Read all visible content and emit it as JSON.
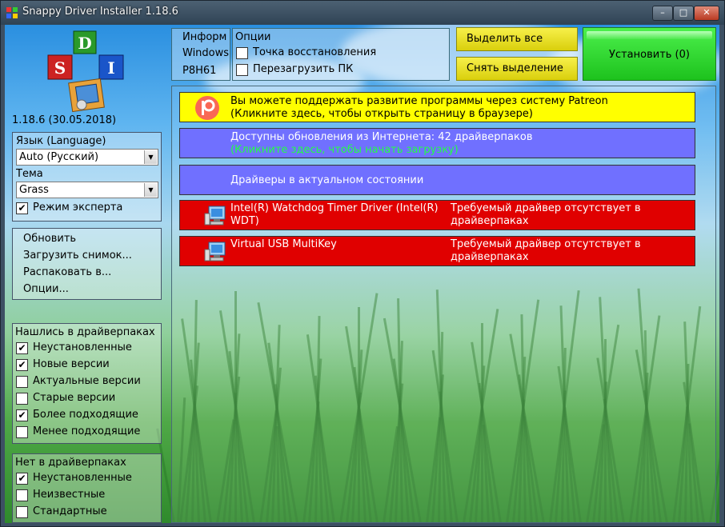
{
  "window": {
    "title": "Snappy Driver Installer 1.18.6",
    "buttons": {
      "minimize": "–",
      "maximize": "□",
      "close": "✕"
    }
  },
  "logo": {
    "letters": [
      "D",
      "S",
      "I"
    ]
  },
  "version": "1.18.6 (30.05.2018)",
  "language": {
    "label": "Язык (Language)",
    "value": "Auto (Русский)"
  },
  "theme": {
    "label": "Тема",
    "value": "Grass"
  },
  "expert_mode": {
    "label": "Режим эксперта",
    "checked": true
  },
  "actions": [
    "Обновить",
    "Загрузить снимок...",
    "Распаковать в...",
    "Опции..."
  ],
  "found_group": {
    "title": "Нашлись в драйверпаках",
    "items": [
      {
        "label": "Неустановленные",
        "checked": true
      },
      {
        "label": "Новые версии",
        "checked": true
      },
      {
        "label": "Актуальные версии",
        "checked": false
      },
      {
        "label": "Старые версии",
        "checked": false
      },
      {
        "label": "Более подходящие",
        "checked": true
      },
      {
        "label": "Менее подходящие",
        "checked": false
      }
    ]
  },
  "notfound_group": {
    "title": "Нет в драйверпаках",
    "items": [
      {
        "label": "Неустановленные",
        "checked": true
      },
      {
        "label": "Неизвестные",
        "checked": false
      },
      {
        "label": "Стандартные",
        "checked": false
      }
    ]
  },
  "info_panel": {
    "lines": [
      "Информ",
      "Windows",
      "P8H61"
    ]
  },
  "options_panel": {
    "title": "Опции",
    "items": [
      {
        "label": "Точка восстановления",
        "checked": false
      },
      {
        "label": "Перезагрузить ПК",
        "checked": false
      }
    ]
  },
  "buttons": {
    "select_all": "Выделить все",
    "deselect": "Снять выделение",
    "install": "Установить (0)"
  },
  "rows": {
    "patreon": {
      "line1": "Вы можете поддержать развитие программы через систему Patreon",
      "line2": "(Кликните здесь, чтобы открыть страницу в браузере)"
    },
    "updates": {
      "line1": "Доступны обновления из Интернета: 42 драйверпаков",
      "line2": "(Кликните здесь, чтобы начать загрузку)"
    },
    "uptodate": {
      "line1": "Драйверы в актуальном состоянии"
    },
    "driver1": {
      "name_line1": "Intel(R) Watchdog Timer Driver (Intel(R)",
      "name_line2": "WDT)",
      "status_line1": "Требуемый драйвер отсутствует в",
      "status_line2": "драйверпаках"
    },
    "driver2": {
      "name_line1": "Virtual USB MultiKey",
      "status_line1": "Требуемый драйвер отсутствует в",
      "status_line2": "драйверпаках"
    }
  },
  "colors": {
    "patreon_bg": "#ffff00",
    "updates_bg": "#7070ff",
    "updates_hint": "#22ff44",
    "missing_bg": "#e00000",
    "install_bg": "#22cc22"
  }
}
